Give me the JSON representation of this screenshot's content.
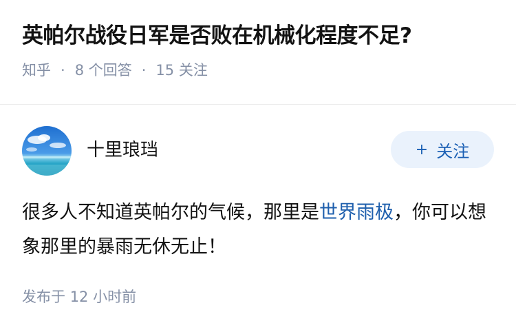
{
  "question": {
    "title": "英帕尔战役日军是否败在机械化程度不足?",
    "source": "知乎",
    "separator": "·",
    "answers_count": "8 个回答",
    "followers_count": "15 关注"
  },
  "answer": {
    "author": {
      "name": "十里琅珰",
      "avatar_icon": "sky-sea-avatar"
    },
    "follow_button": {
      "icon": "+",
      "label": "关注"
    },
    "content": {
      "part1": "很多人不知道英帕尔的气候，那里是",
      "link": "世界雨极",
      "part2": "，你可以想象那里的暴雨无休无止！"
    },
    "time": {
      "prefix": "发布于",
      "value": "12 小时前"
    }
  },
  "colors": {
    "meta": "#8590a6",
    "link": "#1e5fad",
    "follow_bg": "#eaf2fc",
    "follow_text": "#1a5fb4"
  }
}
